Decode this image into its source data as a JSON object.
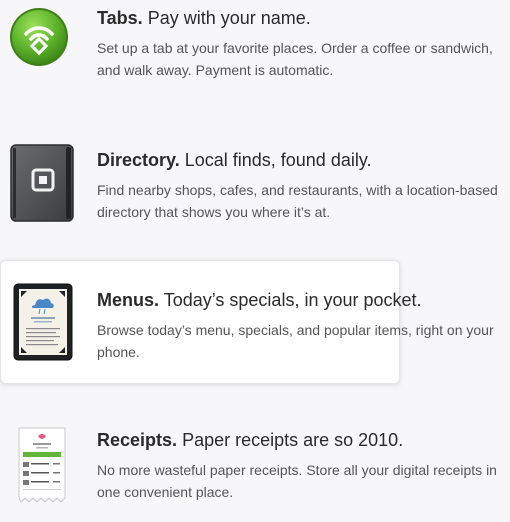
{
  "features": [
    {
      "name": "Tabs.",
      "tagline": "Pay with your name.",
      "description": "Set up a tab at your favorite places. Order a coffee or sandwich, and walk away. Payment is automatic.",
      "icon": "tab-signal-icon",
      "color": "#5fb32d"
    },
    {
      "name": "Directory.",
      "tagline": "Local finds, found daily.",
      "description": "Find nearby shops, cafes, and restaurants, with a location-based directory that shows you where it’s at.",
      "icon": "directory-book-icon",
      "color": "#4a4c50"
    },
    {
      "name": "Menus.",
      "tagline": "Today’s specials, in your pocket.",
      "description": "Browse today’s menu, specials, and popular items, right on your phone.",
      "icon": "menu-card-icon",
      "highlighted": true
    },
    {
      "name": "Receipts.",
      "tagline": "Paper receipts are so 2010.",
      "description": "No more wasteful paper receipts. Store all your digital receipts in one convenient place.",
      "icon": "receipt-icon"
    }
  ]
}
